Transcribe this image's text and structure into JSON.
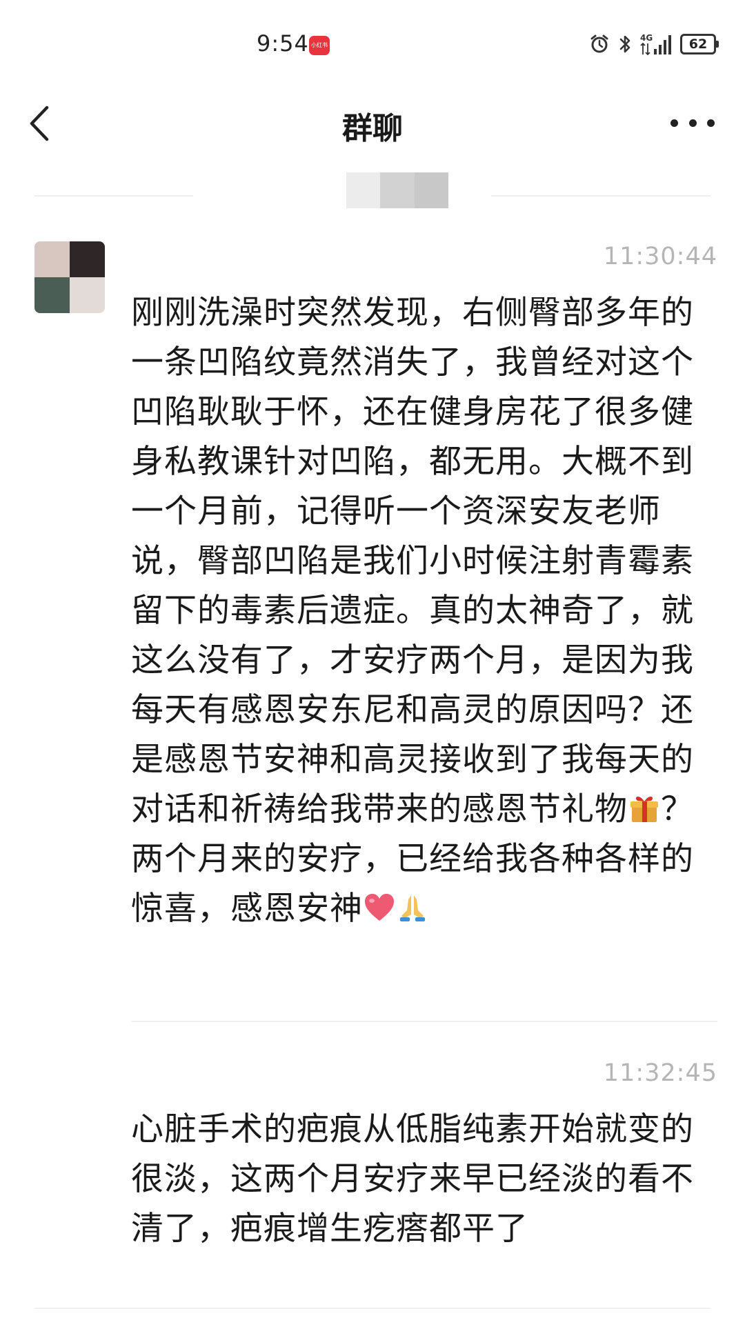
{
  "status_bar": {
    "time": "9:54",
    "app_badge": "小红书",
    "network": "4G",
    "battery": "62",
    "icons": [
      "alarm-icon",
      "bluetooth-icon",
      "signal-icon",
      "battery-icon"
    ]
  },
  "header": {
    "title": "群聊",
    "back_icon": "chevron-left-icon",
    "more_icon": "more-dots-icon"
  },
  "messages": [
    {
      "time": "11:30:44",
      "text_before_gift": "刚刚洗澡时突然发现，右侧臀部多年的一条凹陷纹竟然消失了，我曾经对这个凹陷耿耿于怀，还在健身房花了很多健身私教课针对凹陷，都无用。大概不到一个月前，记得听一个资深安友老师说，臀部凹陷是我们小时候注射青霉素留下的毒素后遗症。真的太神奇了，就这么没有了，才安疗两个月，是因为我每天有感恩安东尼和高灵的原因吗？还是感恩节安神和高灵接收到了我每天的对话和祈祷给我带来的感恩节礼物",
      "text_after_gift": "？两个月来的安疗，已经给我各种各样的惊喜，感恩安神",
      "emojis": [
        "gift-emoji",
        "heart-emoji",
        "praying-hands-emoji"
      ]
    },
    {
      "time": "11:32:45",
      "text": "心脏手术的疤痕从低脂纯素开始就变的很淡，这两个月安疗来早已经淡的看不清了，疤痕增生疙瘩都平了"
    }
  ],
  "colors": {
    "background": "#ffffff",
    "text": "#1a1a1a",
    "timestamp": "#b5b5b5",
    "divider": "#f0f0f0",
    "badge": "#e9343f"
  }
}
